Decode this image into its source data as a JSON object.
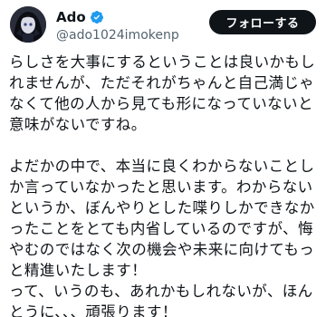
{
  "author": {
    "display_name": "Ado",
    "handle": "@ado1024imokenp",
    "verified": true,
    "verified_color": "#1d9bf0"
  },
  "follow_button": {
    "label": "フォローする"
  },
  "tweet": {
    "text": "らしさを大事にするということは良いかもしれませんが、ただそれがちゃんと自己満じゃなくて他の人から見ても形になっていないと意味がないですね。\n\nよだかの中で、本当に良くわからないことしか言っていなかったと思います。わからないというか、ぼんやりとした喋りしかできなかったことをとても内省しているのですが、悔やむのではなく次の機会や未来に向けてもっと精進いたします！\nって、いうのも、あれかもしれないが、ほんとうに、、、頑張ります！"
  },
  "colors": {
    "text": "#0f1419",
    "secondary": "#536471",
    "button_bg": "#0f1419",
    "button_text": "#ffffff"
  }
}
